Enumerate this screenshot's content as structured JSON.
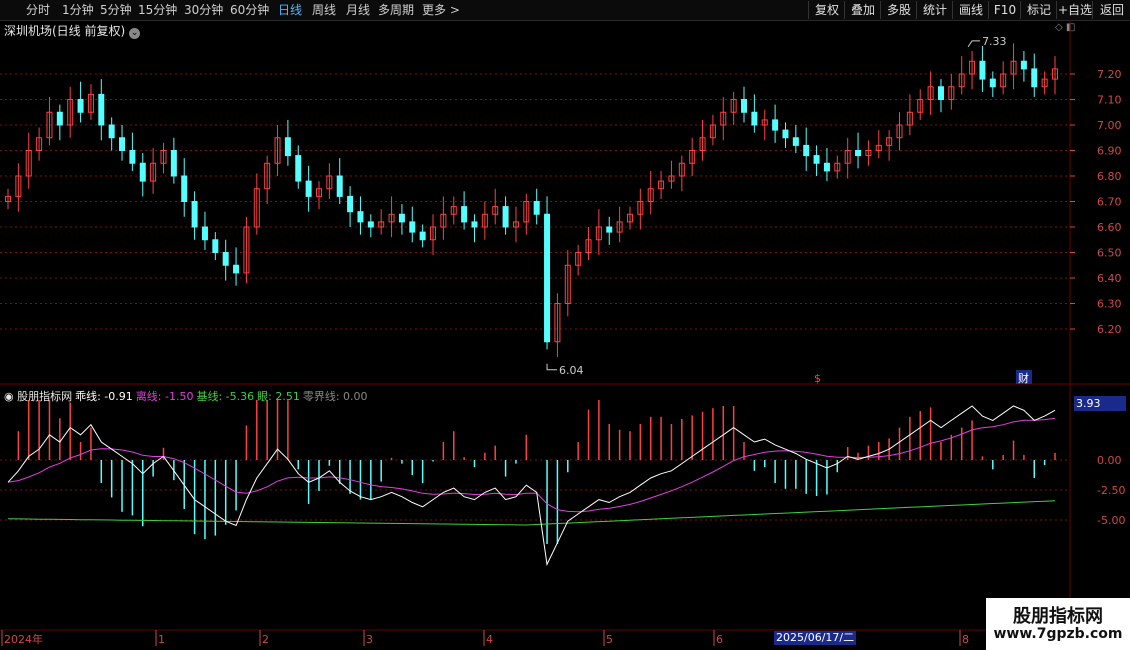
{
  "toolbar": {
    "periods": [
      "分时",
      "1分钟",
      "5分钟",
      "15分钟",
      "30分钟",
      "60分钟",
      "日线",
      "周线",
      "月线",
      "多周期",
      "更多 >"
    ],
    "active_period": "日线",
    "buttons": [
      "复权",
      "叠加",
      "多股",
      "统计",
      "画线",
      "F10",
      "标记",
      "+自选",
      "返回"
    ]
  },
  "stock": {
    "title": "深圳机场(日线 前复权)"
  },
  "price_axis": [
    "7.20",
    "7.10",
    "7.00",
    "6.90",
    "6.80",
    "6.70",
    "6.60",
    "6.50",
    "6.40",
    "6.30",
    "6.20"
  ],
  "annotations": {
    "high": "7.33",
    "low": "6.04",
    "marker_s": "$",
    "marker_cai": "财"
  },
  "indicator": {
    "name": "股朋指标网",
    "fields": [
      {
        "label": "乖线:",
        "value": "-0.91",
        "color": "#ffffff"
      },
      {
        "label": "离线:",
        "value": "-1.50",
        "color": "#e040e0"
      },
      {
        "label": "基线:",
        "value": "-5.36",
        "color": "#40d040"
      },
      {
        "label": "眼:",
        "value": "2.51",
        "color": "#40d040"
      },
      {
        "label": "零界线:",
        "value": "0.00",
        "color": "#888888"
      }
    ],
    "axis": [
      "0.00",
      "-2.50",
      "-5.00"
    ],
    "badge": "3.93"
  },
  "time_axis": {
    "labels": [
      "2024年",
      "1",
      "2",
      "3",
      "4",
      "5",
      "6",
      "8"
    ],
    "cursor_date": "2025/06/17/二"
  },
  "watermark": {
    "line1": "股朋指标网",
    "line2": "www.7gpzb.com"
  },
  "colors": {
    "up": "#ff4040",
    "down": "#54ffff",
    "grid": "#7a1010",
    "bg": "#000000"
  },
  "chart_data": {
    "type": "candlestick",
    "closes": [
      6.72,
      6.8,
      6.9,
      6.95,
      7.05,
      7.0,
      7.1,
      7.05,
      7.12,
      7.0,
      6.95,
      6.9,
      6.85,
      6.78,
      6.85,
      6.9,
      6.8,
      6.7,
      6.6,
      6.55,
      6.5,
      6.45,
      6.42,
      6.6,
      6.75,
      6.85,
      6.95,
      6.88,
      6.78,
      6.72,
      6.75,
      6.8,
      6.72,
      6.66,
      6.62,
      6.6,
      6.62,
      6.65,
      6.62,
      6.58,
      6.55,
      6.6,
      6.65,
      6.68,
      6.62,
      6.6,
      6.65,
      6.68,
      6.6,
      6.62,
      6.7,
      6.65,
      6.15,
      6.3,
      6.45,
      6.5,
      6.55,
      6.6,
      6.58,
      6.62,
      6.65,
      6.7,
      6.75,
      6.78,
      6.8,
      6.85,
      6.9,
      6.95,
      7.0,
      7.05,
      7.1,
      7.05,
      7.0,
      7.02,
      6.98,
      6.95,
      6.92,
      6.88,
      6.85,
      6.82,
      6.85,
      6.9,
      6.88,
      6.9,
      6.92,
      6.95,
      7.0,
      7.05,
      7.1,
      7.15,
      7.1,
      7.15,
      7.2,
      7.25,
      7.18,
      7.15,
      7.2,
      7.25,
      7.22,
      7.15,
      7.18,
      7.22
    ]
  }
}
